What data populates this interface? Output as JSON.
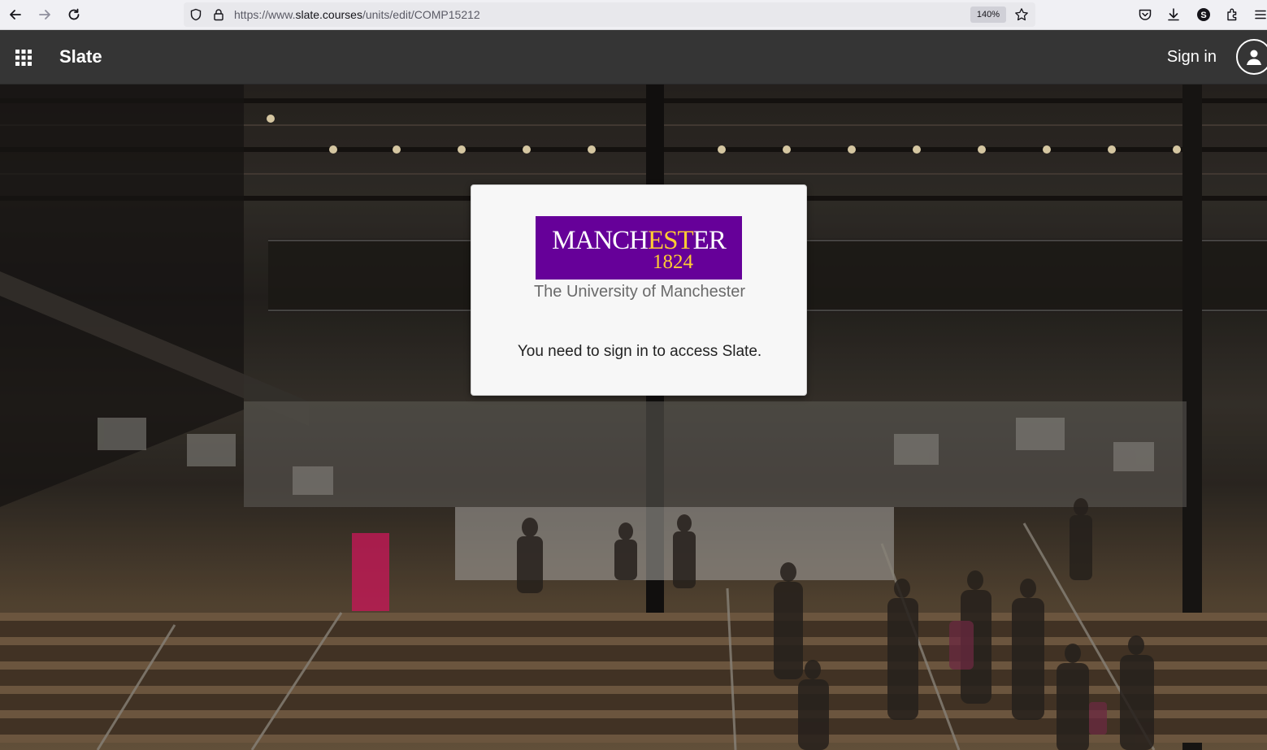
{
  "browser": {
    "url_prefix": "https://www.",
    "url_host": "slate.courses",
    "url_path": "/units/edit/COMP15212",
    "zoom": "140%",
    "icons": [
      "back-icon",
      "forward-icon",
      "reload-icon",
      "shield-icon",
      "lock-icon",
      "star-icon",
      "pocket-icon",
      "download-icon",
      "account-icon",
      "extensions-icon",
      "menu-icon"
    ],
    "account_initial": "S"
  },
  "header": {
    "title": "Slate",
    "sign_in_label": "Sign in",
    "icons": [
      "apps-grid-icon",
      "user-avatar-icon"
    ]
  },
  "modal": {
    "logo_word_part1": "MANCH",
    "logo_word_part2": "EST",
    "logo_word_part3": "ER",
    "logo_year": "1824",
    "university_name": "The University of Manchester",
    "message": "You need to sign in to access Slate."
  },
  "colors": {
    "header_bg": "#353535",
    "logo_purple": "#660099",
    "logo_gold": "#ffcc33"
  }
}
